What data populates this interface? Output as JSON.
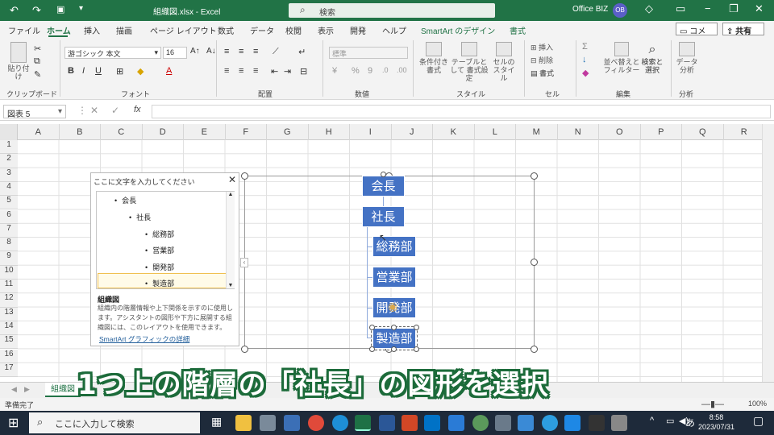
{
  "titlebar": {
    "doc_title": "組織図.xlsx - Excel",
    "search_placeholder": "検索",
    "user": "Office BIZ",
    "avatar": "OB"
  },
  "tabs": [
    "ファイル",
    "ホーム",
    "挿入",
    "描画",
    "ページ レイアウト",
    "数式",
    "データ",
    "校閲",
    "表示",
    "開発",
    "ヘルプ",
    "SmartArt のデザイン",
    "書式"
  ],
  "active_tab": "ホーム",
  "header_buttons": {
    "comment": "コメント",
    "share": "共有"
  },
  "ribbon": {
    "clipboard": {
      "label": "クリップボード",
      "paste": "貼り付け"
    },
    "font": {
      "label": "フォント",
      "name": "游ゴシック 本文",
      "size": "16"
    },
    "alignment": {
      "label": "配置"
    },
    "number": {
      "label": "数値",
      "format": "標準"
    },
    "styles": {
      "label": "スタイル",
      "cond": "条件付き 書式",
      "table": "テーブルとして 書式設定",
      "cell": "セルの スタイル"
    },
    "cells": {
      "label": "セル",
      "insert": "挿入",
      "delete": "削除",
      "format": "書式"
    },
    "editing": {
      "label": "編集",
      "sort": "並べ替えと フィルター",
      "find": "検索と 選択"
    },
    "analysis": {
      "label": "分析",
      "data": "データ 分析"
    }
  },
  "formula_bar": {
    "name_box": "図表 5",
    "fx": "fx"
  },
  "columns": [
    "A",
    "B",
    "C",
    "D",
    "E",
    "F",
    "G",
    "H",
    "I",
    "J",
    "K",
    "L",
    "M",
    "N",
    "O",
    "P",
    "Q",
    "R"
  ],
  "rows": [
    "1",
    "2",
    "3",
    "4",
    "5",
    "6",
    "7",
    "8",
    "9",
    "10",
    "11",
    "12",
    "13",
    "14",
    "15",
    "16",
    "17"
  ],
  "text_pane": {
    "title": "ここに文字を入力してください",
    "items": [
      "会長",
      "社長",
      "総務部",
      "営業部",
      "開発部",
      "製造部"
    ],
    "desc_title": "組織図",
    "desc": "組織内の階層情報や上下関係を示すのに使用します。アシスタントの図形や下方に展開する組織図には、このレイアウトを使用できます。",
    "link": "SmartArt グラフィックの詳細"
  },
  "smartart": {
    "nodes": [
      "会長",
      "社長",
      "総務部",
      "営業部",
      "開発部",
      "製造部"
    ]
  },
  "sheet_tab": "組織図",
  "status": {
    "ready": "準備完了",
    "zoom": "100%"
  },
  "caption": "1つ上の階層の「社長」の図形を選択",
  "taskbar": {
    "search": "ここに入力して検索",
    "time": "8:58",
    "date": "2023/07/31",
    "ime": "あ"
  }
}
